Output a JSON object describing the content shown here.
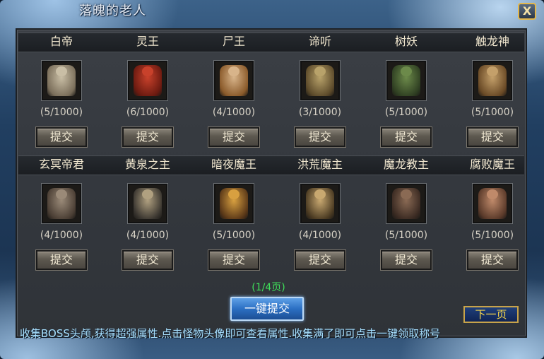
{
  "window": {
    "title": "落魄的老人",
    "close_label": "X"
  },
  "bosses": [
    {
      "name": "白帝",
      "count": "(5/1000)",
      "submit": "提交",
      "colors": [
        "#c9bea5",
        "#7a6e5a"
      ]
    },
    {
      "name": "灵王",
      "count": "(6/1000)",
      "submit": "提交",
      "colors": [
        "#c8412b",
        "#6b1a10"
      ]
    },
    {
      "name": "尸王",
      "count": "(4/1000)",
      "submit": "提交",
      "colors": [
        "#d8b48a",
        "#8a5a2a"
      ]
    },
    {
      "name": "谛听",
      "count": "(3/1000)",
      "submit": "提交",
      "colors": [
        "#b8a26a",
        "#5c4a2a"
      ]
    },
    {
      "name": "树妖",
      "count": "(5/1000)",
      "submit": "提交",
      "colors": [
        "#6c8a4a",
        "#2f3f22"
      ]
    },
    {
      "name": "触龙神",
      "count": "(5/1000)",
      "submit": "提交",
      "colors": [
        "#c4a06a",
        "#6a4a26"
      ]
    },
    {
      "name": "玄冥帝君",
      "count": "(4/1000)",
      "submit": "提交",
      "colors": [
        "#9a8a78",
        "#4a3e34"
      ]
    },
    {
      "name": "黄泉之主",
      "count": "(4/1000)",
      "submit": "提交",
      "colors": [
        "#b0a080",
        "#3a3630"
      ]
    },
    {
      "name": "暗夜魔王",
      "count": "(5/1000)",
      "submit": "提交",
      "colors": [
        "#d8a040",
        "#5a3818"
      ]
    },
    {
      "name": "洪荒魔主",
      "count": "(4/1000)",
      "submit": "提交",
      "colors": [
        "#c8a870",
        "#4a3a22"
      ]
    },
    {
      "name": "魔龙教主",
      "count": "(5/1000)",
      "submit": "提交",
      "colors": [
        "#8a6a54",
        "#3a2a22"
      ]
    },
    {
      "name": "腐败魔王",
      "count": "(5/1000)",
      "submit": "提交",
      "colors": [
        "#c08a6a",
        "#5a3a2a"
      ]
    }
  ],
  "page_indicator": "(1/4页)",
  "one_key_submit": "一键提交",
  "next_page": "下一页",
  "hint": "收集BOSS头颅,获得超强属性.点击怪物头像即可查看属性.收集满了即可点击一键领取称号"
}
